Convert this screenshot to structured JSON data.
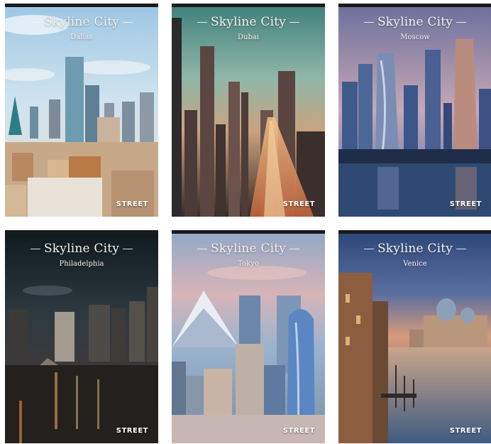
{
  "covers": [
    {
      "title": "Skyline City",
      "city": "Dallas",
      "brand": "STREET"
    },
    {
      "title": "Skyline City",
      "city": "Dubai",
      "brand": "STREET"
    },
    {
      "title": "Skyline City",
      "city": "Moscow",
      "brand": "STREET"
    },
    {
      "title": "Skyline City",
      "city": "Philadelphia",
      "brand": "STREET"
    },
    {
      "title": "Skyline City",
      "city": "Tokyo",
      "brand": "STREET"
    },
    {
      "title": "Skyline City",
      "city": "Venice",
      "brand": "STREET"
    }
  ]
}
